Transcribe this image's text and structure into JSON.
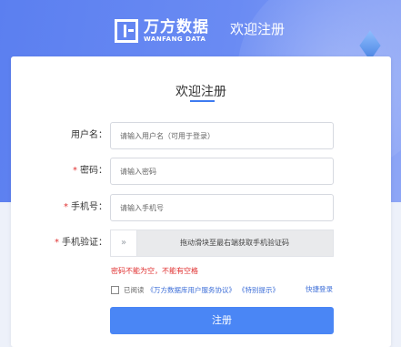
{
  "header": {
    "brand_cn": "万方数据",
    "brand_en": "WANFANG DATA",
    "page_title": "欢迎注册"
  },
  "form": {
    "title": "欢迎注册",
    "username": {
      "label": "用户名：",
      "placeholder": "请输入用户名（可用于登录）",
      "required": false
    },
    "password": {
      "label": "密码：",
      "placeholder": "请输入密码",
      "required": true,
      "required_mark": "*"
    },
    "phone": {
      "label": "手机号：",
      "placeholder": "请输入手机号",
      "required": true,
      "required_mark": "*"
    },
    "verify": {
      "label": "手机验证：",
      "required": true,
      "required_mark": "*",
      "handle": "»",
      "slider_text": "拖动滑块至最右端获取手机验证码"
    },
    "error": "密码不能为空，不能有空格",
    "agree": {
      "prefix": "已阅读",
      "link1": "《万方数据库用户服务协议》",
      "link2": "《特别提示》"
    },
    "quick_login": "快捷登录",
    "submit": "注册"
  },
  "colors": {
    "accent": "#4a86f5",
    "error": "#e03131",
    "link": "#3e6fd8"
  }
}
